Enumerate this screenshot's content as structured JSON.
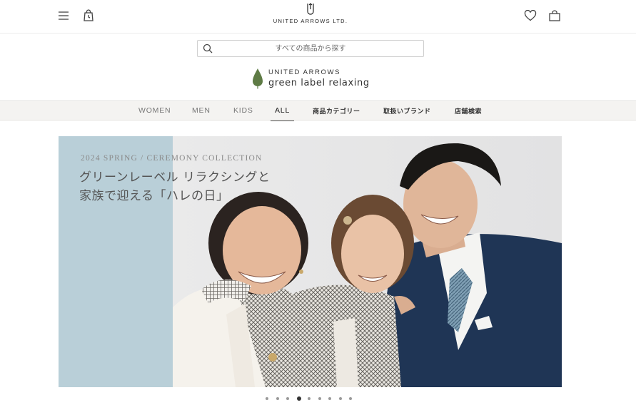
{
  "header": {
    "brand_text": "UNITED ARROWS LTD.",
    "icons": {
      "menu": "hamburger-menu-icon",
      "history": "shopping-history-icon",
      "favorite": "heart-icon",
      "cart": "shopping-bag-icon"
    }
  },
  "search": {
    "placeholder": "すべての商品から探す",
    "icon": "search-icon"
  },
  "sub_brand": {
    "line1": "UNITED ARROWS",
    "line2": "green label relaxing",
    "leaf_color": "#5e7b45"
  },
  "nav": {
    "items": [
      {
        "label": "WOMEN"
      },
      {
        "label": "MEN"
      },
      {
        "label": "KIDS"
      },
      {
        "label": "ALL",
        "active": true
      },
      {
        "label": "商品カテゴリー"
      },
      {
        "label": "取扱いブランド"
      },
      {
        "label": "店舗検索"
      }
    ]
  },
  "hero": {
    "subtitle": "2024 SPRING / CEREMONY COLLECTION",
    "title_line1": "グリーンレーベル リラクシングと",
    "title_line2": "家族で迎える「ハレの日」",
    "panel_color": "#b9cfd8"
  },
  "carousel": {
    "slide_count": 9,
    "active_index": 3
  }
}
